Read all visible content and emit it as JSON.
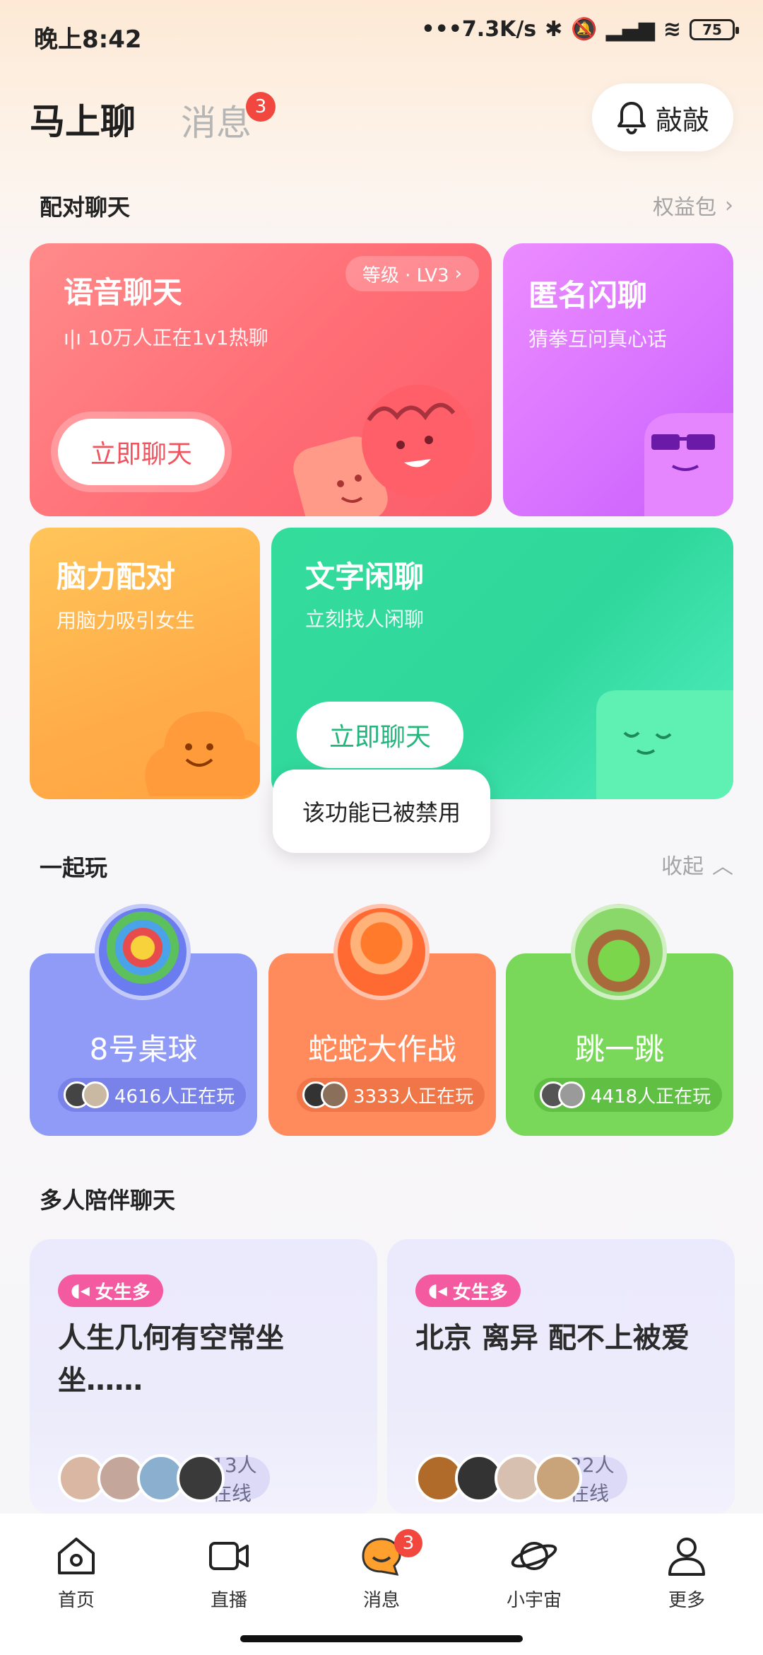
{
  "status_bar": {
    "time": "晚上8:42",
    "network_speed": "•••7.3K/s",
    "battery": "75"
  },
  "header": {
    "tab_main": "马上聊",
    "tab_messages": "消息",
    "messages_badge": "3",
    "knock_button": "敲敲"
  },
  "pair_chat": {
    "title": "配对聊天",
    "link": "权益包",
    "voice": {
      "title": "语音聊天",
      "level": "等级 · LV3",
      "subtitle": "10万人正在1v1热聊",
      "button": "立即聊天"
    },
    "anonymous": {
      "title": "匿名闪聊",
      "subtitle": "猜拳互问真心话"
    },
    "brain": {
      "title": "脑力配对",
      "subtitle": "用脑力吸引女生"
    },
    "text": {
      "title": "文字闲聊",
      "subtitle": "立刻找人闲聊",
      "button": "立即聊天"
    },
    "toast": "该功能已被禁用"
  },
  "play_together": {
    "title": "一起玩",
    "collapse": "收起",
    "games": [
      {
        "name": "8号桌球",
        "players": "4616人正在玩",
        "color": "#8f9bf7"
      },
      {
        "name": "蛇蛇大作战",
        "players": "3333人正在玩",
        "color": "#ff8a5c"
      },
      {
        "name": "跳一跳",
        "players": "4418人正在玩",
        "color": "#79d85a"
      }
    ]
  },
  "group_chat": {
    "title": "多人陪伴聊天",
    "rooms": [
      {
        "tag": "女生多",
        "title": "人生几何有空常坐坐……",
        "online": "13人在线"
      },
      {
        "tag": "女生多",
        "title": "北京 离异 配不上被爱",
        "online": "22人在线"
      }
    ]
  },
  "bottom_nav": {
    "items": [
      {
        "label": "首页",
        "icon": "home-icon"
      },
      {
        "label": "直播",
        "icon": "video-icon"
      },
      {
        "label": "消息",
        "icon": "chat-bubble-icon"
      },
      {
        "label": "小宇宙",
        "icon": "planet-icon"
      },
      {
        "label": "更多",
        "icon": "person-icon"
      }
    ],
    "messages_badge": "3"
  }
}
